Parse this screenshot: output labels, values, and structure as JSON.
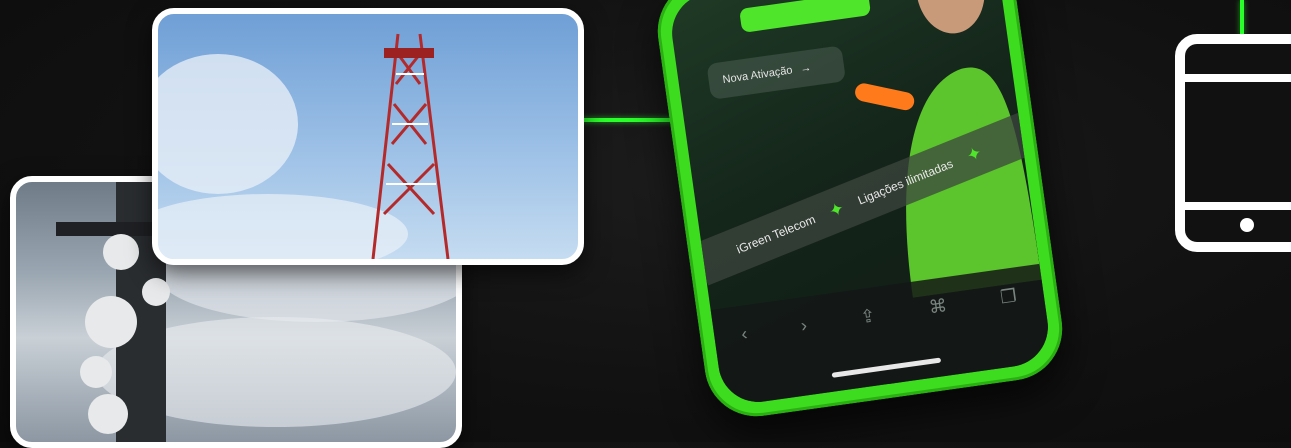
{
  "phone": {
    "activate_label": "Nova Ativação",
    "activate_arrow": "→",
    "marquee_1": "iGreen Telecom",
    "marquee_2": "Ligações ilimitadas",
    "spark": "✦",
    "toolbar": [
      "‹",
      "›",
      "⇪",
      "⌘",
      "❐"
    ]
  },
  "colors": {
    "accent": "#3ddc1e",
    "line": "#2bff2b",
    "background": "#111111"
  },
  "icons": {
    "tablet": "tablet-icon",
    "tower": "antenna-tower-icon"
  }
}
